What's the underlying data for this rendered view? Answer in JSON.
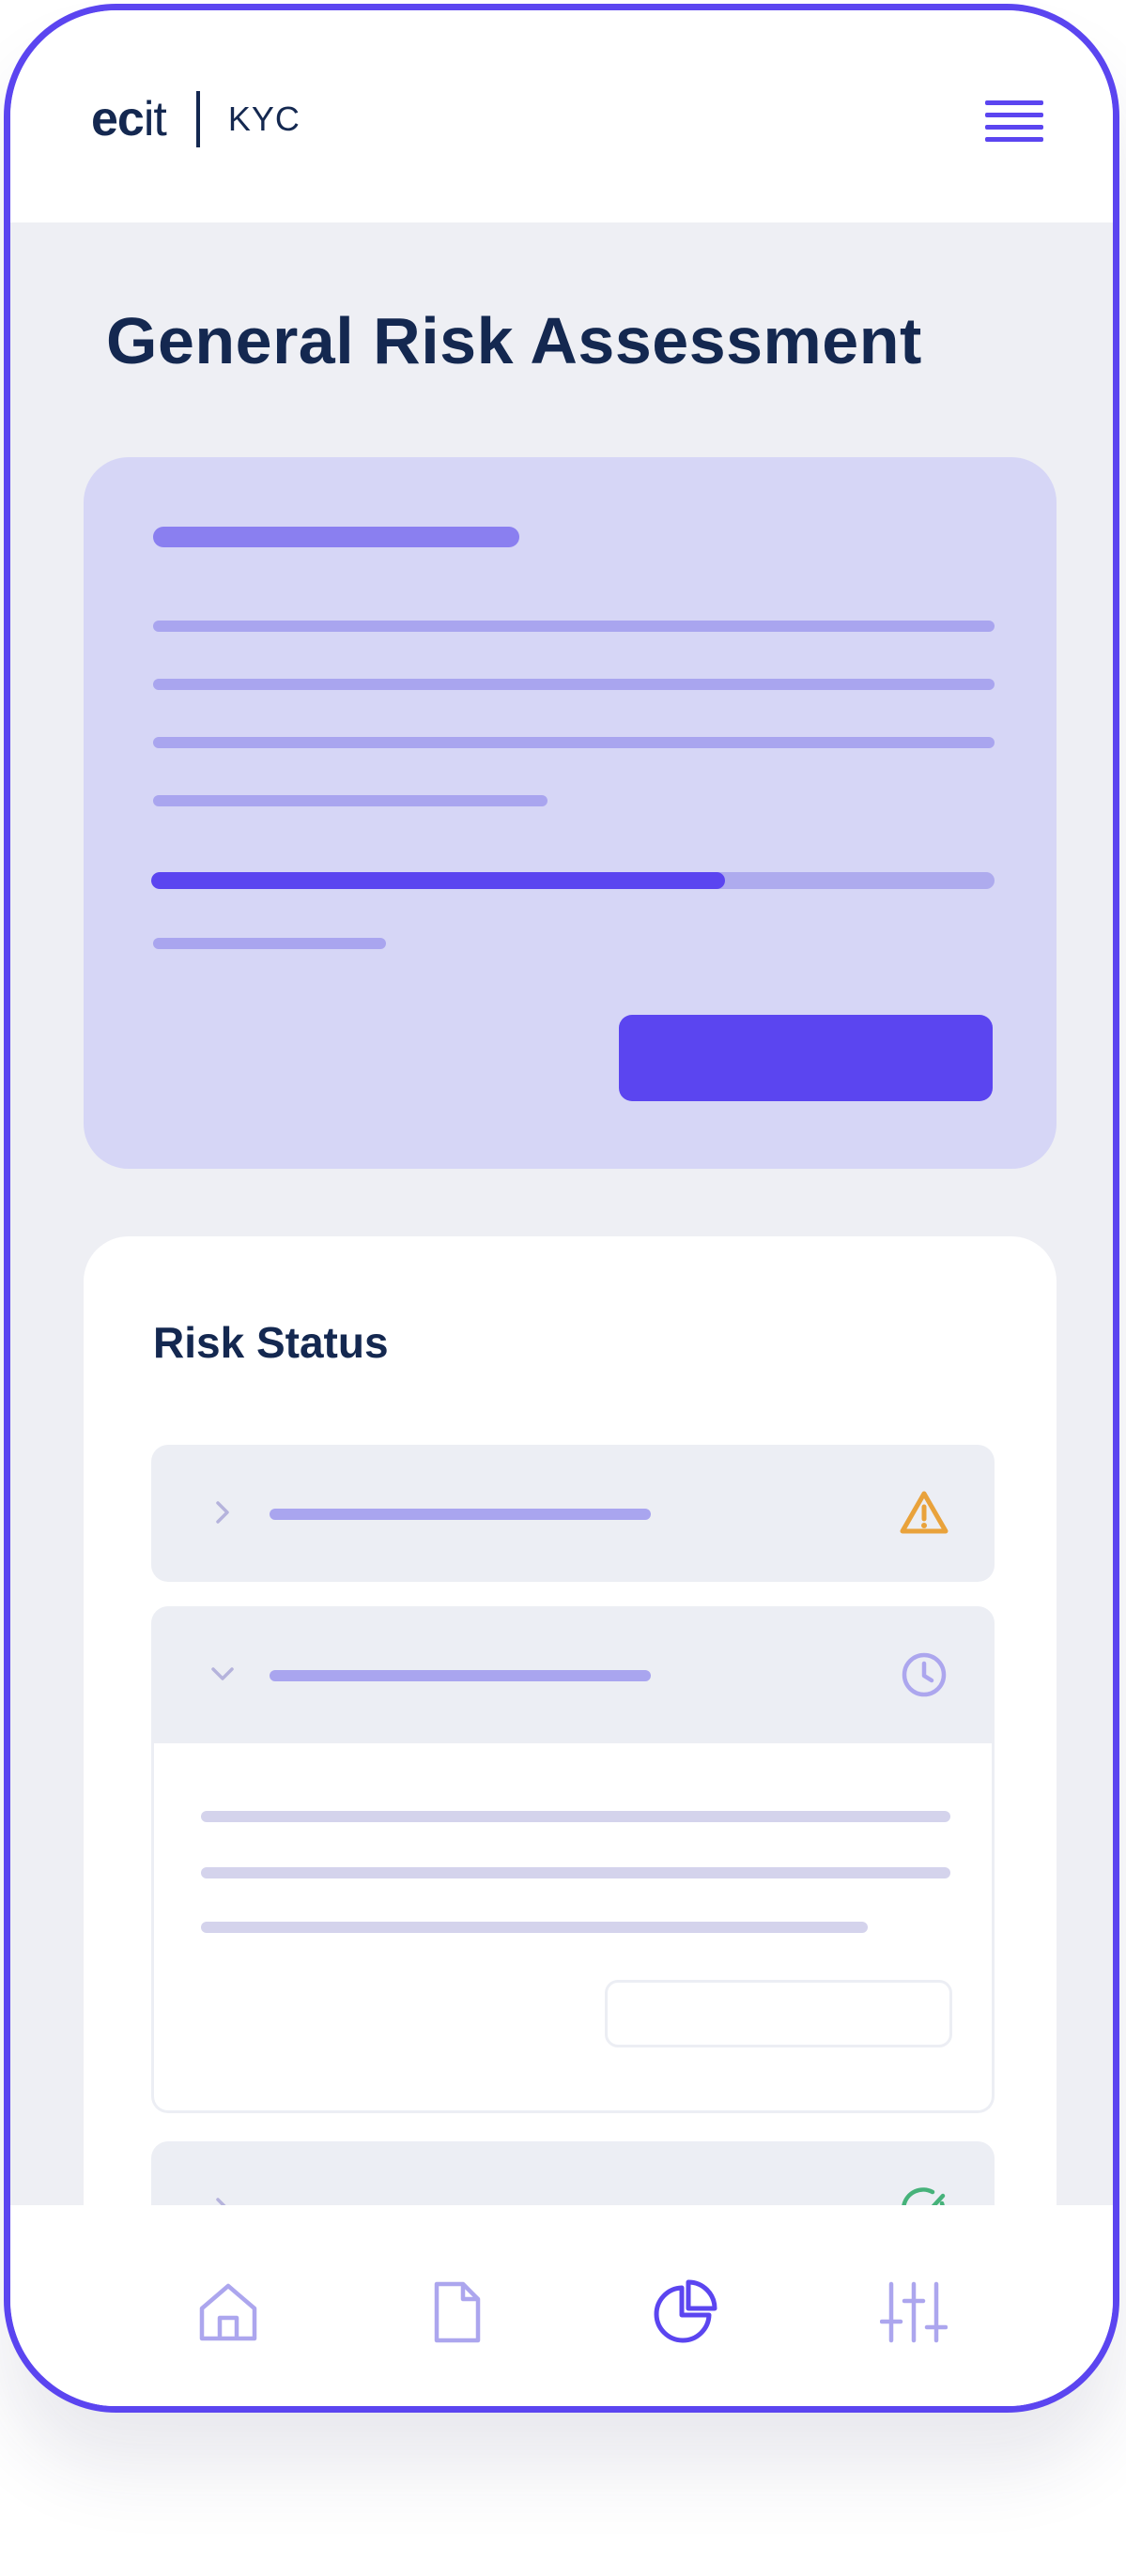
{
  "header": {
    "logo_primary_bold": "ec",
    "logo_primary_light": "it",
    "logo_product": "KYC",
    "menu_icon": "hamburger-menu-icon"
  },
  "page": {
    "title": "General Risk Assessment"
  },
  "summary": {
    "progress_fraction": 0.68
  },
  "risk_status": {
    "title": "Risk Status",
    "items": [
      {
        "state": "collapsed",
        "status_icon": "warning-icon",
        "status_color": "#e9a23b"
      },
      {
        "state": "expanded",
        "status_icon": "clock-icon",
        "status_color": "#aca6ee"
      },
      {
        "state": "collapsed",
        "status_icon": "check-circle-icon",
        "status_color": "#46b27a"
      }
    ]
  },
  "bottom_nav": {
    "items": [
      {
        "icon": "home-icon",
        "active": false
      },
      {
        "icon": "document-icon",
        "active": false
      },
      {
        "icon": "pie-chart-icon",
        "active": true
      },
      {
        "icon": "sliders-icon",
        "active": false
      }
    ]
  },
  "colors": {
    "accent": "#5b45f0",
    "navy": "#142850",
    "background": "#eeeff4",
    "card_lavender": "#d6d6f6",
    "placeholder": "#a9a5ef",
    "icon_inactive": "#aca6ee"
  }
}
